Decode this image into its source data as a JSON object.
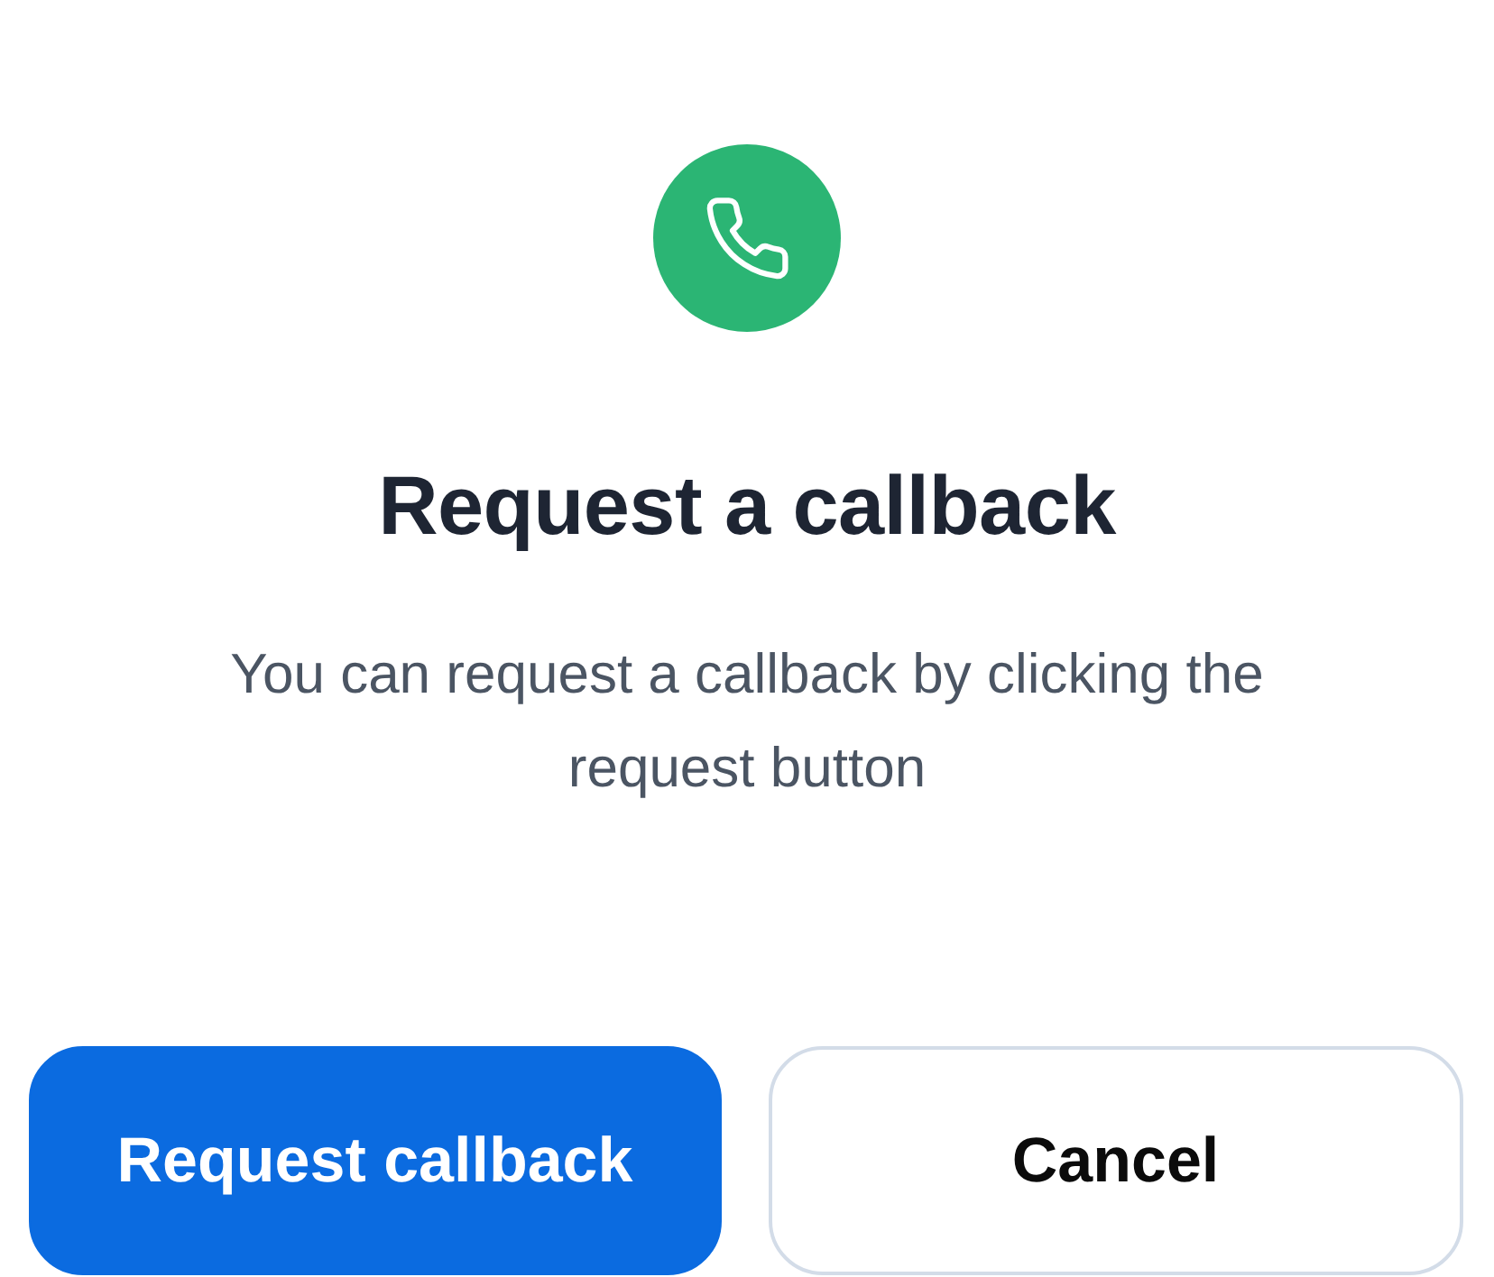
{
  "title": "Request a callback",
  "description": "You can request a callback by clicking the request button",
  "buttons": [
    {
      "label": "Request callback",
      "kind": "primary"
    },
    {
      "label": "Cancel",
      "kind": "secondary"
    }
  ]
}
